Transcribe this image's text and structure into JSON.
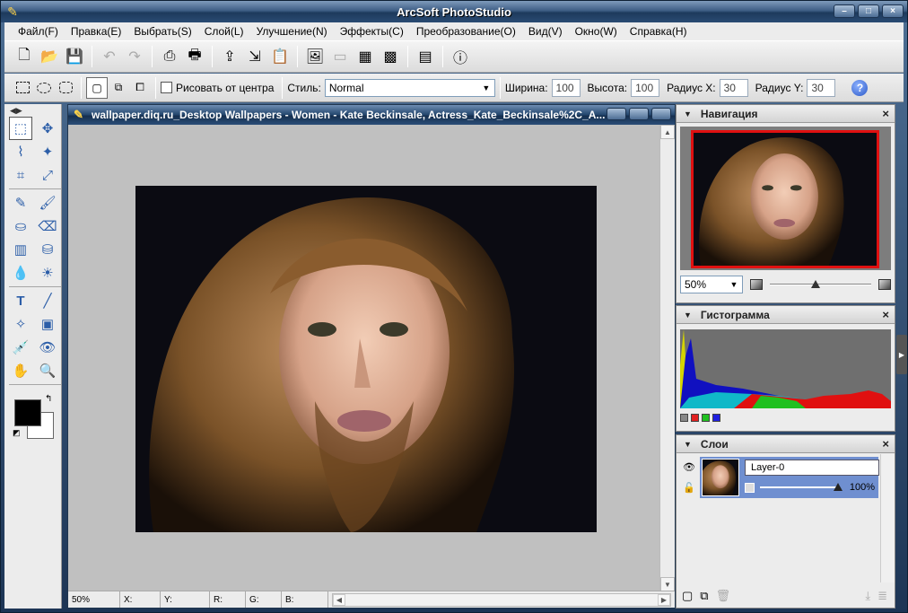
{
  "window": {
    "title": "ArcSoft PhotoStudio",
    "controls": [
      "minimize",
      "maximize",
      "close"
    ]
  },
  "menu": [
    {
      "label": "Файл(F)"
    },
    {
      "label": "Правка(E)"
    },
    {
      "label": "Выбрать(S)"
    },
    {
      "label": "Слой(L)"
    },
    {
      "label": "Улучшение(N)"
    },
    {
      "label": "Эффекты(C)"
    },
    {
      "label": "Преобразование(O)"
    },
    {
      "label": "Вид(V)"
    },
    {
      "label": "Окно(W)"
    },
    {
      "label": "Справка(H)"
    }
  ],
  "toolbar": {
    "icons": [
      "new-icon",
      "open-icon",
      "save-icon",
      "undo-icon",
      "redo-icon",
      "scan-icon",
      "print-icon",
      "export-icon",
      "import-icon",
      "paste-icon",
      "image-icon",
      "frame-icon",
      "layout-icon",
      "album-icon",
      "slideshow-icon",
      "info-icon"
    ]
  },
  "options": {
    "draw_from_center_label": "Рисовать от центра",
    "style_label": "Стиль:",
    "style_value": "Normal",
    "width_label": "Ширина:",
    "width_value": "100",
    "height_label": "Высота:",
    "height_value": "100",
    "radius_x_label": "Радиус X:",
    "radius_x_value": "30",
    "radius_y_label": "Радиус Y:",
    "radius_y_value": "30"
  },
  "document": {
    "title": "wallpaper.diq.ru_Desktop Wallpapers - Women - Kate Beckinsale, Actress_Kate_Beckinsale%2C_A...",
    "status": {
      "zoom": "50%",
      "x_label": "X:",
      "y_label": "Y:",
      "r_label": "R:",
      "g_label": "G:",
      "b_label": "B:"
    }
  },
  "colors": {
    "foreground": "#000000",
    "background": "#ffffff",
    "nav_frame": "#e01010",
    "layer_selected": "#6f8fd0"
  },
  "panels": {
    "navigation": {
      "title": "Навигация",
      "zoom_value": "50%",
      "zoom_slider_fraction": 0.45
    },
    "histogram": {
      "title": "Гистограмма",
      "channels": [
        "#888888",
        "#e02020",
        "#20c020",
        "#2020e0"
      ]
    },
    "layers": {
      "title": "Слои",
      "items": [
        {
          "name": "Layer-0",
          "opacity": "100%",
          "opacity_fraction": 1.0
        }
      ]
    }
  }
}
